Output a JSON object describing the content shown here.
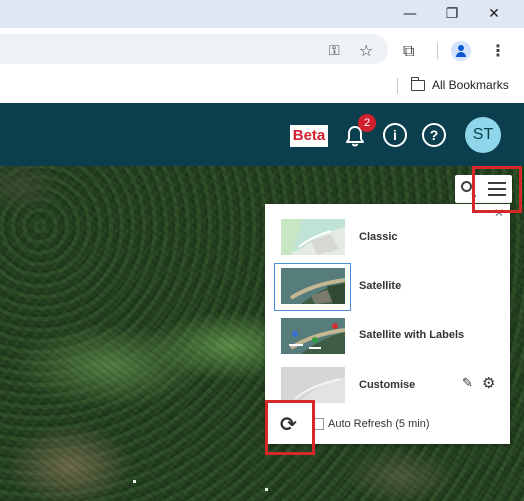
{
  "browser": {
    "window_controls": {
      "minimize": "—",
      "restore": "❐",
      "close": "✕"
    },
    "toolbar_icons": [
      "key-icon",
      "star-icon",
      "extensions-icon",
      "profile-icon",
      "menu-icon"
    ],
    "bookmarks": {
      "label": "All Bookmarks"
    }
  },
  "header": {
    "beta_label": "Beta",
    "notification_count": "2",
    "info_glyph": "i",
    "help_glyph": "?",
    "avatar_initials": "ST"
  },
  "basemap_panel": {
    "options": [
      {
        "label": "Classic",
        "selected": false
      },
      {
        "label": "Satellite",
        "selected": true
      },
      {
        "label": "Satellite with Labels",
        "selected": false
      },
      {
        "label": "Customise",
        "selected": false
      }
    ],
    "auto_refresh_label": "Auto Refresh (5 min)",
    "auto_refresh_checked": false
  },
  "colors": {
    "header_bg": "#0b3f4d",
    "beta_text": "#d1202f",
    "badge": "#d1202f",
    "avatar_bg": "#8fd6ea",
    "highlight_border": "#d62828",
    "selection_border": "#4a90d9"
  }
}
